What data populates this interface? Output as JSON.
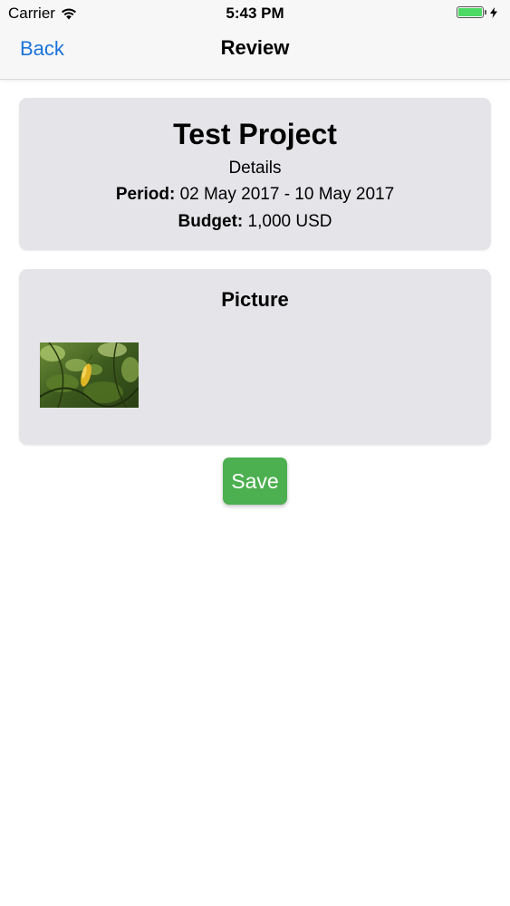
{
  "status_bar": {
    "carrier": "Carrier",
    "time": "5:43 PM",
    "battery_level": 1.0,
    "battery_color": "#4cd964",
    "signal_icon": "wifi-icon",
    "charging_icon": "charging-bolt-icon"
  },
  "nav": {
    "back_label": "Back",
    "title": "Review",
    "accent_color": "#1a73d9"
  },
  "project": {
    "title": "Test Project",
    "subtitle": "Details",
    "period_label": "Period:",
    "period_value": "02 May 2017 - 10 May 2017",
    "budget_label": "Budget:",
    "budget_value": "1,000 USD"
  },
  "picture": {
    "heading": "Picture",
    "thumbnail_icon": "photo-thumbnail"
  },
  "actions": {
    "save_label": "Save",
    "save_color": "#4caf50"
  }
}
